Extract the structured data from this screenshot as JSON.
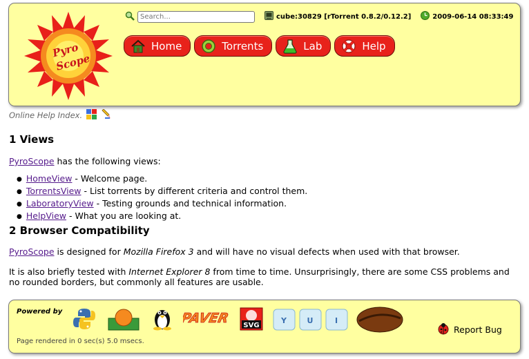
{
  "header": {
    "logo_text": "Pyro Scope",
    "search": {
      "value": "",
      "placeholder": "Search..."
    },
    "host_status": "cube:30829 [rTorrent 0.8.2/0.12.2]",
    "clock": "2009-06-14 08:33:49",
    "nav": [
      {
        "label": "Home",
        "icon": "house-icon"
      },
      {
        "label": "Torrents",
        "icon": "torrent-icon"
      },
      {
        "label": "Lab",
        "icon": "flask-icon"
      },
      {
        "label": "Help",
        "icon": "lifebuoy-icon"
      }
    ]
  },
  "content": {
    "help_index": "Online Help Index.",
    "section1_title": "1 Views",
    "section1_link": "PyroScope",
    "section1_text": " has the following views:",
    "views": [
      {
        "link": "HomeView",
        "text": " - Welcome page."
      },
      {
        "link": "TorrentsView",
        "text": " - List torrents by different criteria and control them."
      },
      {
        "link": "LaboratoryView",
        "text": " - Testing grounds and technical information."
      },
      {
        "link": "HelpView",
        "text": " - What you are looking at."
      }
    ],
    "section2_title": "2 Browser Compatibility",
    "compat_link": "PyroScope",
    "compat_text1": " is designed for ",
    "compat_browser1": "Mozilla Firefox 3",
    "compat_text2": " and will have no visual defects when used with that browser.",
    "ie_text1": "It is also briefly tested with ",
    "ie_browser": "Internet Explorer 8",
    "ie_text2": " from time to time. Unsurprisingly, there are some CSS problems and no rounded borders, but commonly all features are usable."
  },
  "footer": {
    "powered_by": "Powered by",
    "render_time": "Page rendered in 0 sec(s) 5.0 msecs.",
    "report_bug": "Report Bug",
    "paver_text": "PAVER",
    "svg_text": "SVG",
    "yui_letters": [
      "Y",
      "U",
      "I"
    ]
  },
  "colors": {
    "panel_bg": "#ffffa0",
    "nav_red": "#e8221b",
    "link": "#551a8b"
  }
}
